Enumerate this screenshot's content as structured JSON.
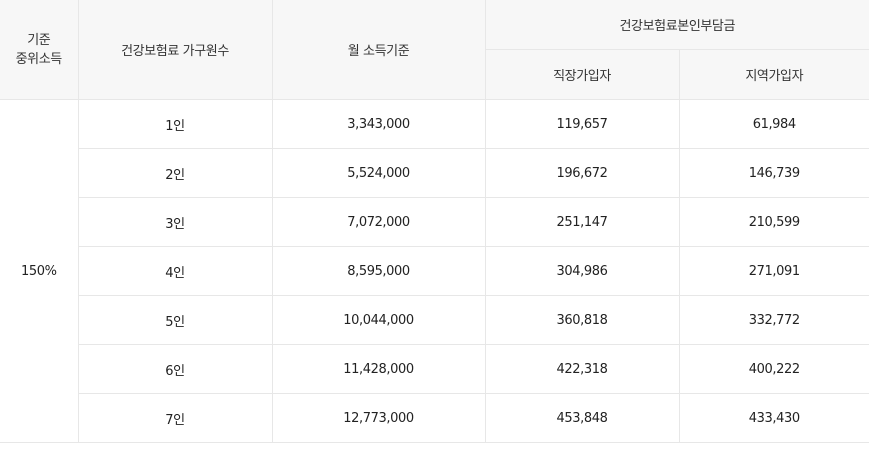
{
  "table": {
    "header": {
      "median_income": "기준\n중위소득",
      "household_size": "건강보험료 가구원수",
      "monthly_income": "월 소득기준",
      "premium_group": "건강보험료본인부담금",
      "employee": "직장가입자",
      "regional": "지역가입자"
    },
    "median_value": "150%",
    "rows": [
      {
        "size": "1인",
        "income": "3,343,000",
        "employee": "119,657",
        "regional": "61,984"
      },
      {
        "size": "2인",
        "income": "5,524,000",
        "employee": "196,672",
        "regional": "146,739"
      },
      {
        "size": "3인",
        "income": "7,072,000",
        "employee": "251,147",
        "regional": "210,599"
      },
      {
        "size": "4인",
        "income": "8,595,000",
        "employee": "304,986",
        "regional": "271,091"
      },
      {
        "size": "5인",
        "income": "10,044,000",
        "employee": "360,818",
        "regional": "332,772"
      },
      {
        "size": "6인",
        "income": "11,428,000",
        "employee": "422,318",
        "regional": "400,222"
      },
      {
        "size": "7인",
        "income": "12,773,000",
        "employee": "453,848",
        "regional": "433,430"
      }
    ]
  }
}
